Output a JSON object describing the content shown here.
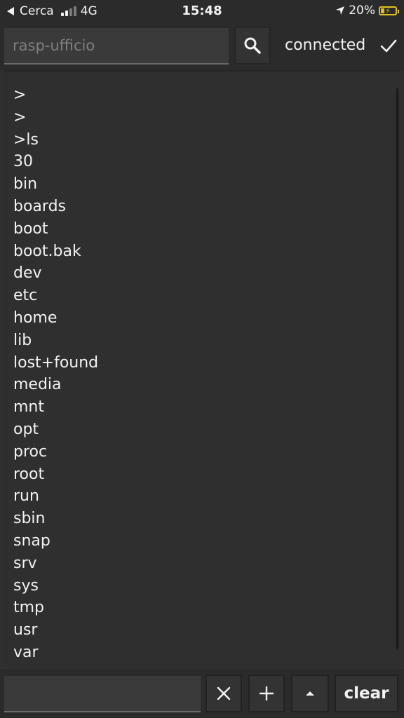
{
  "status_bar": {
    "carrier": "Cerca",
    "network": "4G",
    "time": "15:48",
    "battery_percent": "20%",
    "battery_level": 0.2,
    "battery_color": "#e0c021",
    "icons": [
      "back-arrow-icon",
      "signal-icon",
      "location-arrow-icon",
      "battery-charging-icon"
    ]
  },
  "header": {
    "host_placeholder": "rasp-ufficio",
    "search_icon": "search-icon",
    "connection_status": "connected",
    "status_icon": "checkmark-icon"
  },
  "terminal": {
    "lines": [
      ">",
      ">",
      ">ls",
      "30",
      "bin",
      "boards",
      "boot",
      "boot.bak",
      "dev",
      "etc",
      "home",
      "lib",
      "lost+found",
      "media",
      "mnt",
      "opt",
      "proc",
      "root",
      "run",
      "sbin",
      "snap",
      "srv",
      "sys",
      "tmp",
      "usr",
      "var",
      ">"
    ]
  },
  "footer": {
    "command_value": "",
    "close_icon": "close-icon",
    "add_icon": "plus-icon",
    "up_icon": "caret-up-icon",
    "clear_label": "clear"
  },
  "colors": {
    "background": "#303030",
    "bar_background": "#2b2b2b",
    "text": "#f2f2f2"
  }
}
